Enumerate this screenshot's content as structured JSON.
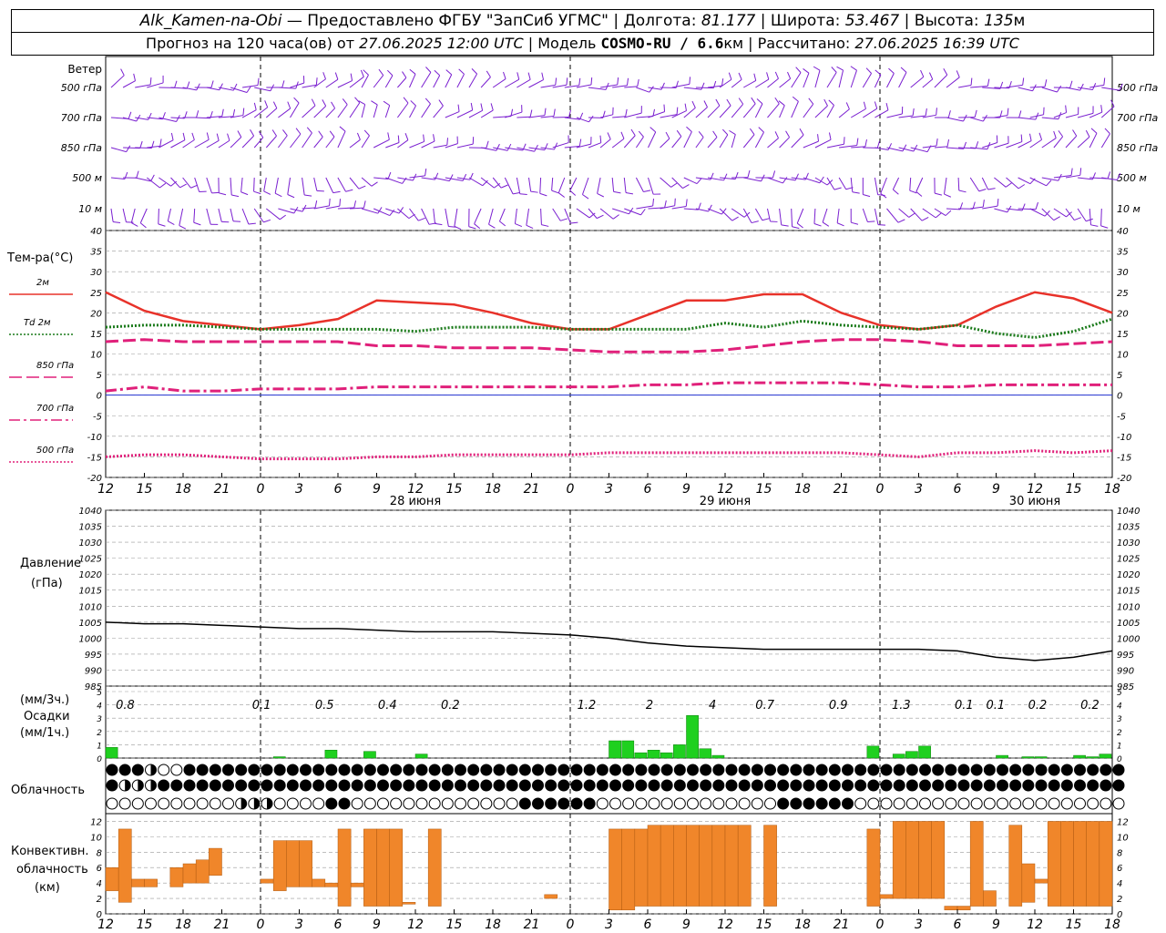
{
  "header": {
    "station": "Alk_Kamen-na-Obi",
    "provider": "— Предоставлено ФГБУ \"ЗапСиб УГМС\"",
    "lon_label": "Долгота:",
    "lon_value": "81.177",
    "lat_label": "Широта:",
    "lat_value": "53.467",
    "alt_label": "Высота:",
    "alt_value": "135",
    "alt_unit": "м",
    "forecast_label": "Прогноз на 120 часа(ов) от",
    "forecast_from": "27.06.2025 12:00 UTC",
    "model_label": "| Модель",
    "model_value": "COSMO-RU / 6.6",
    "model_unit": "км",
    "calc_label": "| Рассчитано:",
    "calc_value": "27.06.2025 16:39 UTC",
    "sep": "|"
  },
  "wind_panel": {
    "title": "Ветер",
    "levels": [
      "500 гПа",
      "700 гПа",
      "850 гПа",
      "500 м",
      "10  м"
    ],
    "right_levels": [
      "500 гПа",
      "700 гПа",
      "850 гПа",
      "500 м",
      "10  м"
    ],
    "barb_color": "#7a1fd0"
  },
  "time_axis": {
    "hour_labels": [
      "12",
      "15",
      "18",
      "21",
      "0",
      "3",
      "6",
      "9",
      "12",
      "15",
      "18",
      "21",
      "0",
      "3",
      "6",
      "9",
      "12",
      "15",
      "18",
      "21",
      "0",
      "3",
      "6",
      "9",
      "12",
      "15",
      "18"
    ],
    "day_labels": [
      "28 июня",
      "29 июня",
      "30 июня"
    ]
  },
  "temperature_panel": {
    "title": "Тем-ра(°C)",
    "legend": [
      {
        "label": "2м",
        "color": "#e8322a",
        "style": "solid"
      },
      {
        "label": "Td  2м",
        "color": "#1a7a1a",
        "style": "dotted"
      },
      {
        "label": "850 гПа",
        "color": "#e0207a",
        "style": "dashed"
      },
      {
        "label": "700 гПа",
        "color": "#e0207a",
        "style": "dashdot"
      },
      {
        "label": "500 гПа",
        "color": "#e0207a",
        "style": "dotted"
      }
    ],
    "y_ticks": [
      "40",
      "35",
      "30",
      "25",
      "20",
      "15",
      "10",
      "5",
      "0",
      "-5",
      "-10",
      "-15",
      "-20"
    ]
  },
  "pressure_panel": {
    "title": "Давление",
    "unit": "(гПа)",
    "y_ticks": [
      "1040",
      "1035",
      "1030",
      "1025",
      "1020",
      "1015",
      "1010",
      "1005",
      "1000",
      "995",
      "990",
      "985"
    ]
  },
  "precip_panel": {
    "title_top": "(мм/3ч.)",
    "title": "Осадки",
    "title_unit": "(мм/1ч.)",
    "y_ticks": [
      "5",
      "4",
      "3",
      "2",
      "1",
      "0"
    ],
    "amount_labels": [
      "0.8",
      "0.1",
      "0.5",
      "0.4",
      "0.2",
      "1.2",
      "2",
      "4",
      "0.7",
      "0.9",
      "1.3",
      "0.1",
      "0.1",
      "0.2",
      "0.2"
    ],
    "bar_color": "#1fd01f"
  },
  "cloud_panel": {
    "title": "Облачность",
    "rows": [
      "dddcooddddddddddddddddddddddddddddddddddddddddddddddddddddddddddddddddddddddddddddddddddddddddddddddddddddd",
      "dcccdddddddddddddddddddddddddddddddddddddddddddddddddddddddddddddddddddddddddddddddddddddddddddddddddddd",
      "oooooooooocccooooddoooooooooooooddddddooooooooooooooddddddoooooooooooooooooooooooooooooooooooooooooooooo"
    ]
  },
  "convective_panel": {
    "title1": "Конвективн.",
    "title2": "облачность",
    "unit": "(км)",
    "y_ticks": [
      "12",
      "10",
      "8",
      "6",
      "4",
      "2",
      "0"
    ],
    "bar_color": "#f0862a"
  },
  "chart_data": [
    {
      "type": "line",
      "title": "Тем-ра(°C)",
      "ylim": [
        -20,
        40
      ],
      "x_hours": [
        0,
        3,
        6,
        9,
        12,
        15,
        18,
        21,
        24,
        27,
        30,
        33,
        36,
        39,
        42,
        45,
        48,
        51,
        54,
        57,
        60,
        63,
        66,
        69,
        72,
        75,
        78
      ],
      "series": [
        {
          "name": "2м",
          "values": [
            25,
            20.5,
            18,
            17,
            16,
            17,
            18.5,
            23,
            22.5,
            22,
            20,
            17.5,
            16,
            16,
            19.5,
            23,
            23,
            24.5,
            24.5,
            20,
            17,
            16,
            17,
            21.5,
            25,
            23.5,
            20
          ]
        },
        {
          "name": "Td  2м",
          "values": [
            16.5,
            17,
            17,
            16.5,
            16,
            16,
            16,
            16,
            15.5,
            16.5,
            16.5,
            16.5,
            16,
            16,
            16,
            16,
            17.5,
            16.5,
            18,
            17,
            16.5,
            16,
            17,
            15,
            14,
            15.5,
            18.5
          ]
        },
        {
          "name": "850 гПа",
          "values": [
            13,
            13.5,
            13,
            13,
            13,
            13,
            13,
            12,
            12,
            11.5,
            11.5,
            11.5,
            11,
            10.5,
            10.5,
            10.5,
            11,
            12,
            13,
            13.5,
            13.5,
            13,
            12,
            12,
            12,
            12.5,
            13
          ]
        },
        {
          "name": "700 гПа",
          "values": [
            1,
            2,
            1,
            1,
            1.5,
            1.5,
            1.5,
            2,
            2,
            2,
            2,
            2,
            2,
            2,
            2.5,
            2.5,
            3,
            3,
            3,
            3,
            2.5,
            2,
            2,
            2.5,
            2.5,
            2.5,
            2.5
          ]
        },
        {
          "name": "500 гПа",
          "values": [
            -15,
            -14.5,
            -14.5,
            -15,
            -15.5,
            -15.5,
            -15.5,
            -15,
            -15,
            -14.5,
            -14.5,
            -14.5,
            -14.5,
            -14,
            -14,
            -14,
            -14,
            -14,
            -14,
            -14,
            -14.5,
            -15,
            -14,
            -14,
            -13.5,
            -14,
            -13.5
          ]
        }
      ]
    },
    {
      "type": "line",
      "title": "Давление",
      "ylim": [
        985,
        1040
      ],
      "x_hours": [
        0,
        3,
        6,
        9,
        12,
        15,
        18,
        21,
        24,
        27,
        30,
        33,
        36,
        39,
        42,
        45,
        48,
        51,
        54,
        57,
        60,
        63,
        66,
        69,
        72,
        75,
        78
      ],
      "series": [
        {
          "name": "Давление",
          "values": [
            1005,
            1004.5,
            1004.5,
            1004,
            1003.5,
            1003,
            1003,
            1002.5,
            1002,
            1002,
            1002,
            1001.5,
            1001,
            1000,
            998.5,
            997.5,
            997,
            996.5,
            996.5,
            996.5,
            996.5,
            996.5,
            996,
            994,
            993,
            994,
            996
          ]
        }
      ]
    },
    {
      "type": "bar",
      "title": "Осадки",
      "ylim": [
        0,
        5
      ],
      "x_hours": [
        0,
        1,
        2,
        3,
        4,
        5,
        6,
        7,
        8,
        9,
        10,
        11,
        12,
        13,
        14,
        15,
        16,
        17,
        18,
        19,
        20,
        21,
        22,
        23,
        24,
        25,
        26,
        27,
        28,
        29,
        30,
        31,
        32,
        33,
        34,
        35,
        36,
        37,
        38,
        39,
        40,
        41,
        42,
        43,
        44,
        45,
        46,
        47,
        48,
        49,
        50,
        51,
        52,
        53,
        54,
        55,
        56,
        57,
        58,
        59,
        60,
        61,
        62,
        63,
        64,
        65,
        66,
        67,
        68,
        69,
        70,
        71,
        72,
        73,
        74,
        75,
        76,
        77,
        78
      ],
      "values": [
        0.8,
        0,
        0,
        0,
        0,
        0,
        0,
        0,
        0,
        0,
        0,
        0,
        0,
        0.1,
        0,
        0,
        0,
        0.6,
        0,
        0,
        0.5,
        0,
        0,
        0,
        0.3,
        0,
        0,
        0,
        0,
        0,
        0,
        0,
        0,
        0,
        0,
        0,
        0,
        0,
        0,
        1.3,
        1.3,
        0.4,
        0.6,
        0.4,
        1,
        3.2,
        0.7,
        0.2,
        0,
        0,
        0,
        0,
        0,
        0,
        0,
        0,
        0,
        0,
        0,
        0.9,
        0,
        0.3,
        0.5,
        0.9,
        0,
        0,
        0,
        0,
        0,
        0.2,
        0,
        0.1,
        0.1,
        0,
        0,
        0.2,
        0.1,
        0.3,
        0
      ]
    },
    {
      "type": "bar",
      "title": "Конвективн. облачность",
      "ylim": [
        0,
        13
      ],
      "x_hours": [
        0,
        1,
        2,
        3,
        5,
        6,
        7,
        8,
        12,
        13,
        14,
        15,
        16,
        17,
        18,
        19,
        20,
        21,
        22,
        23,
        25,
        34,
        39,
        40,
        41,
        42,
        43,
        44,
        45,
        46,
        47,
        48,
        49,
        51,
        59,
        60,
        61,
        62,
        63,
        64,
        65,
        66,
        67,
        68,
        70,
        71,
        72,
        73,
        74,
        75,
        76,
        77
      ],
      "bottoms": [
        3,
        1.5,
        3.5,
        3.5,
        3.5,
        4,
        4,
        5,
        4,
        3,
        3.5,
        3.5,
        3.5,
        3.5,
        1,
        3.5,
        1,
        1,
        1,
        1.5,
        1,
        2,
        0.5,
        0.5,
        1,
        1,
        1,
        1,
        1,
        1,
        1,
        1,
        1,
        1,
        1,
        2,
        2,
        2,
        2,
        2,
        0.5,
        0.5,
        1,
        1,
        1,
        1.5,
        4,
        1,
        1,
        1,
        1,
        1
      ],
      "tops": [
        6,
        11,
        4.5,
        4.5,
        6,
        6.5,
        7,
        8.5,
        4.5,
        9.5,
        9.5,
        9.5,
        4.5,
        4,
        11,
        4,
        11,
        11,
        11,
        1.5,
        11,
        2.5,
        11,
        11,
        11,
        11.5,
        11.5,
        11.5,
        11.5,
        11.5,
        11.5,
        11.5,
        11.5,
        11.5,
        11,
        2.5,
        12,
        12,
        12,
        12,
        1,
        1,
        12,
        3,
        11.5,
        6.5,
        4.5,
        12,
        12,
        12,
        12,
        12
      ]
    }
  ]
}
